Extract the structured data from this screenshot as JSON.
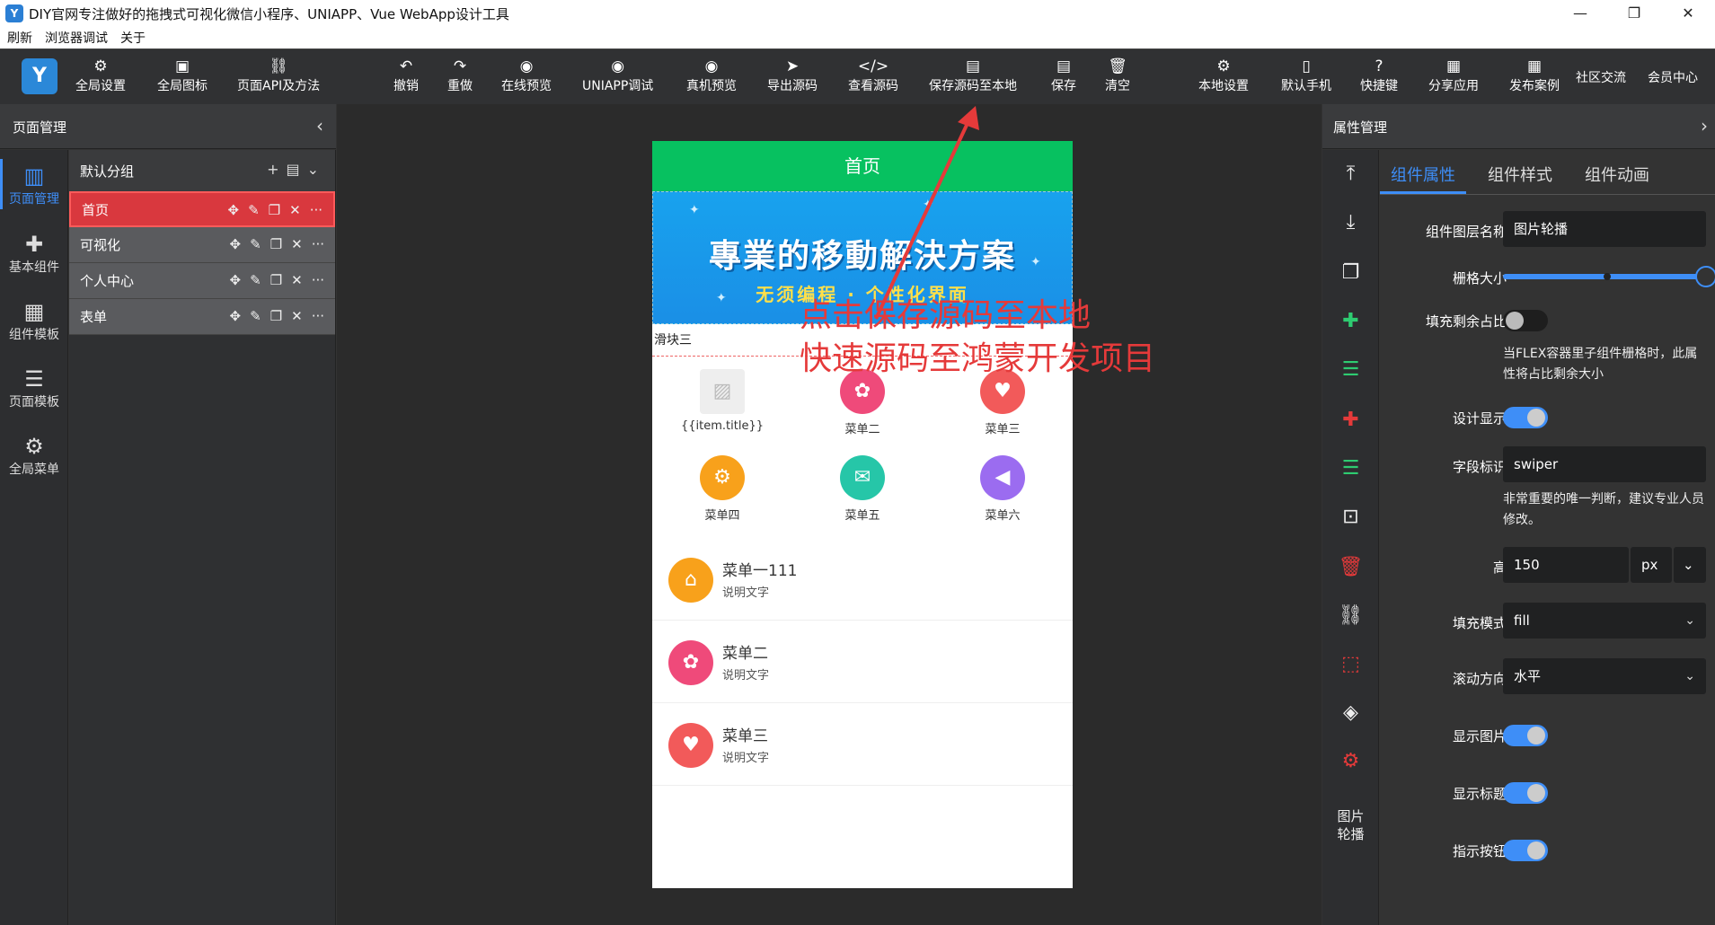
{
  "window": {
    "title": "DIY官网专注做好的拖拽式可视化微信小程序、UNIAPP、Vue WebApp设计工具",
    "minimize": "—",
    "maximize": "❐",
    "close": "✕"
  },
  "menubar": [
    "刷新",
    "浏览器调试",
    "关于"
  ],
  "toolbar": {
    "logo": "Y",
    "left": [
      {
        "label": "全局设置",
        "icon": "gear-icon",
        "glyph": "⚙"
      },
      {
        "label": "全局图标",
        "icon": "image-icon",
        "glyph": "▣"
      },
      {
        "label": "页面API及方法",
        "icon": "link-icon",
        "glyph": "⛓"
      }
    ],
    "middle": [
      {
        "label": "撤销",
        "icon": "undo-icon",
        "glyph": "↶"
      },
      {
        "label": "重做",
        "icon": "redo-icon",
        "glyph": "↷"
      },
      {
        "label": "在线预览",
        "icon": "eye-icon",
        "glyph": "◉"
      },
      {
        "label": "UNIAPP调试",
        "icon": "eye-icon",
        "glyph": "◉"
      },
      {
        "label": "真机预览",
        "icon": "eye-icon",
        "glyph": "◉"
      },
      {
        "label": "导出源码",
        "icon": "send-icon",
        "glyph": "➤"
      },
      {
        "label": "查看源码",
        "icon": "code-icon",
        "glyph": "</>"
      },
      {
        "label": "保存源码至本地",
        "icon": "save-icon",
        "glyph": "▤"
      },
      {
        "label": "保存",
        "icon": "save-icon",
        "glyph": "▤"
      },
      {
        "label": "清空",
        "icon": "trash-icon",
        "glyph": "🗑"
      }
    ],
    "right": [
      {
        "label": "本地设置",
        "icon": "gear-icon",
        "glyph": "⚙"
      },
      {
        "label": "默认手机",
        "icon": "phone-icon",
        "glyph": "▯"
      },
      {
        "label": "快捷键",
        "icon": "help-icon",
        "glyph": "?"
      },
      {
        "label": "分享应用",
        "icon": "share-icon",
        "glyph": "▦"
      },
      {
        "label": "发布案例",
        "icon": "publish-icon",
        "glyph": "▦"
      },
      {
        "label": "社区交流",
        "icon": "",
        "glyph": ""
      },
      {
        "label": "会员中心",
        "icon": "",
        "glyph": ""
      }
    ]
  },
  "left_panel": {
    "title": "页面管理",
    "rail": [
      {
        "label": "页面管理",
        "icon": "layout-icon",
        "glyph": "▥"
      },
      {
        "label": "基本组件",
        "icon": "puzzle-icon",
        "glyph": "✚"
      },
      {
        "label": "组件模板",
        "icon": "template-icon",
        "glyph": "▦"
      },
      {
        "label": "页面模板",
        "icon": "database-icon",
        "glyph": "☰"
      },
      {
        "label": "全局菜单",
        "icon": "gear-icon",
        "glyph": "⚙"
      }
    ],
    "group": "默认分组",
    "pages": [
      "首页",
      "可视化",
      "个人中心",
      "表单"
    ]
  },
  "phone": {
    "header": "首页",
    "banner_title": "專業的移動解決方案",
    "banner_subtitle": "无须编程 · 个性化界面",
    "slide_label": "滑块三",
    "grid": [
      {
        "label": "{{item.title}}",
        "color": "#eeeeee",
        "glyph": "▨"
      },
      {
        "label": "菜单二",
        "color": "#ef4a7a",
        "glyph": "✿"
      },
      {
        "label": "菜单三",
        "color": "#f25a5a",
        "glyph": "♥"
      },
      {
        "label": "菜单四",
        "color": "#f8a11b",
        "glyph": "⚙"
      },
      {
        "label": "菜单五",
        "color": "#26c6a8",
        "glyph": "✉"
      },
      {
        "label": "菜单六",
        "color": "#9b6cf0",
        "glyph": "◀"
      }
    ],
    "list": [
      {
        "title": "菜单一111",
        "desc": "说明文字",
        "color": "#f8a11b",
        "glyph": "⌂"
      },
      {
        "title": "菜单二",
        "desc": "说明文字",
        "color": "#ef4a7a",
        "glyph": "✿"
      },
      {
        "title": "菜单三",
        "desc": "说明文字",
        "color": "#f25a5a",
        "glyph": "♥"
      }
    ]
  },
  "annotation": {
    "line1": "点击保存源码至本地",
    "line2": "快速源码至鸿蒙开发项目",
    "color": "#e53a3a"
  },
  "right_panel": {
    "title": "属性管理",
    "tabs": [
      "组件属性",
      "组件样式",
      "组件动画"
    ],
    "tools": [
      {
        "icon": "move-top-icon",
        "glyph": "⤒",
        "tone": ""
      },
      {
        "icon": "move-bottom-icon",
        "glyph": "⤓",
        "tone": ""
      },
      {
        "icon": "copy-icon",
        "glyph": "❐",
        "tone": ""
      },
      {
        "icon": "puzzle-icon",
        "glyph": "✚",
        "tone": "green"
      },
      {
        "icon": "document-icon",
        "glyph": "☰",
        "tone": "green"
      },
      {
        "icon": "puzzle-icon",
        "glyph": "✚",
        "tone": "red"
      },
      {
        "icon": "document-add-icon",
        "glyph": "☰",
        "tone": "green"
      },
      {
        "icon": "unlock-icon",
        "glyph": "⊡",
        "tone": ""
      },
      {
        "icon": "trash-icon",
        "glyph": "🗑",
        "tone": "red"
      },
      {
        "icon": "link-icon",
        "glyph": "⛓",
        "tone": ""
      },
      {
        "icon": "select-icon",
        "glyph": "⬚",
        "tone": "red"
      },
      {
        "icon": "layers-icon",
        "glyph": "◈",
        "tone": ""
      },
      {
        "icon": "gear-icon",
        "glyph": "⚙",
        "tone": "red"
      }
    ],
    "component_name_line1": "图片",
    "component_name_line2": "轮播",
    "props": {
      "layer_name_label": "组件图层名称",
      "layer_name_value": "图片轮播",
      "grid_size_label": "栅格大小",
      "fill_rest_label": "填充剩余占比",
      "fill_rest_note": "当FLEX容器里子组件栅格时，此属性将占比剩余大小",
      "design_show_label": "设计显示",
      "field_id_label": "字段标识",
      "field_id_value": "swiper",
      "field_id_note": "非常重要的唯一判断，建议专业人员修改。",
      "height_label": "高",
      "height_value": "150",
      "height_unit": "px",
      "fill_mode_label": "填充模式",
      "fill_mode_value": "fill",
      "scroll_dir_label": "滚动方向",
      "scroll_dir_value": "水平",
      "show_image_label": "显示图片",
      "show_title_label": "显示标题",
      "indicator_label": "指示按钮"
    }
  }
}
